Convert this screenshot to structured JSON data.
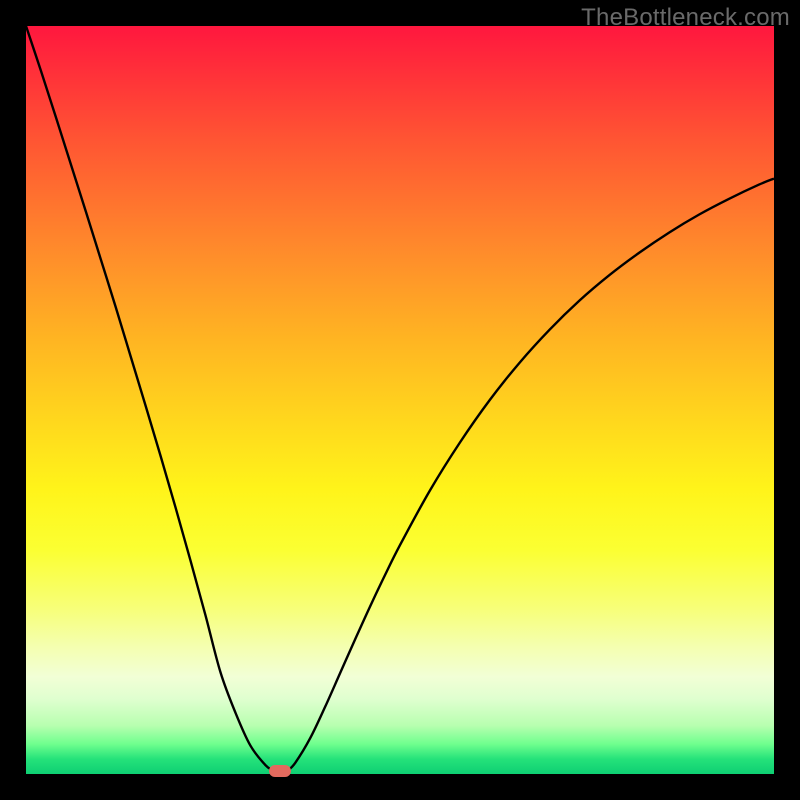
{
  "watermark": "TheBottleneck.com",
  "colors": {
    "background": "#000000",
    "curve": "#000000",
    "dot": "#e26a5e",
    "gradient_top": "#ff173e",
    "gradient_bottom": "#0ecf73"
  },
  "chart_data": {
    "type": "line",
    "title": "",
    "xlabel": "",
    "ylabel": "",
    "xlim": [
      0,
      100
    ],
    "ylim": [
      0,
      100
    ],
    "x": [
      0,
      2,
      4,
      6,
      8,
      10,
      12,
      14,
      16,
      18,
      20,
      22,
      24,
      26,
      28,
      30,
      32,
      33,
      34,
      35,
      36,
      38,
      40,
      42,
      44,
      46,
      48,
      50,
      54,
      58,
      62,
      66,
      70,
      74,
      78,
      82,
      86,
      90,
      94,
      98,
      100
    ],
    "values": [
      100,
      94,
      87.8,
      81.5,
      75.2,
      68.8,
      62.4,
      55.8,
      49.2,
      42.5,
      35.6,
      28.5,
      21.2,
      13.6,
      8.2,
      3.8,
      1.2,
      0.5,
      0,
      0.5,
      1.5,
      4.8,
      9.0,
      13.5,
      18.0,
      22.4,
      26.6,
      30.6,
      37.9,
      44.3,
      50.0,
      55.0,
      59.4,
      63.3,
      66.7,
      69.7,
      72.4,
      74.8,
      76.9,
      78.8,
      79.6
    ],
    "annotations": [
      {
        "kind": "marker",
        "x": 34,
        "y": 0
      }
    ]
  }
}
